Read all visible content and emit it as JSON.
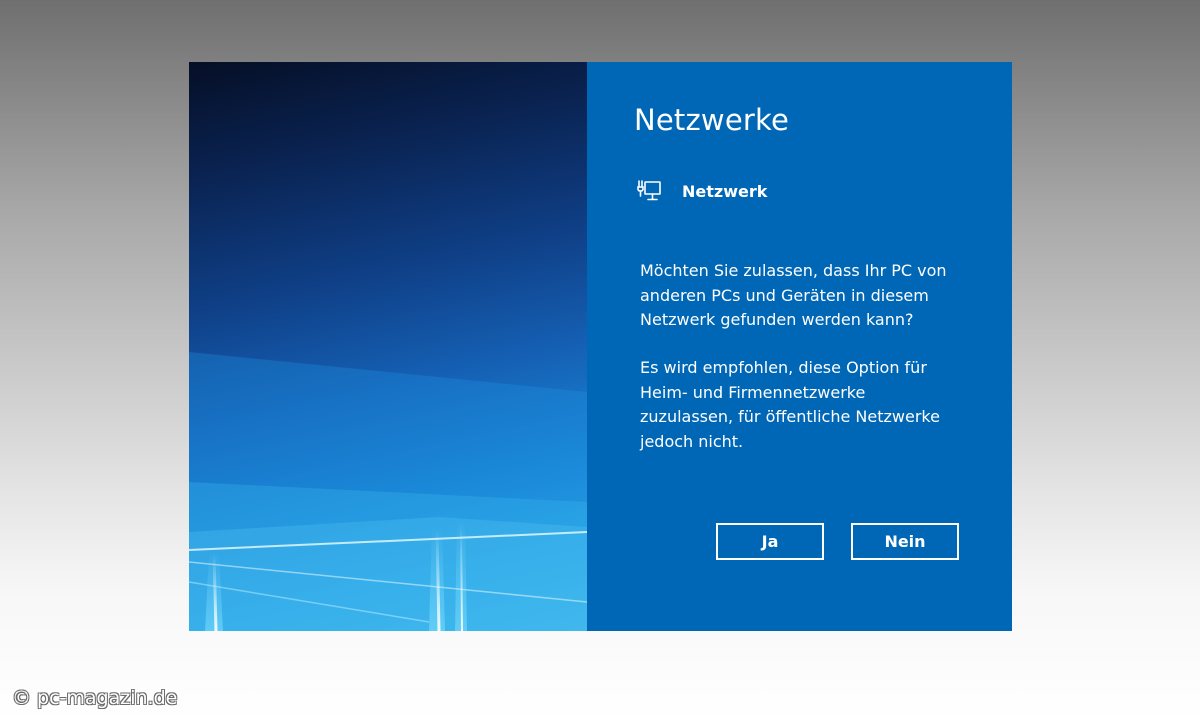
{
  "dialog": {
    "title": "Netzwerke",
    "network_icon": "network-icon",
    "network_name": "Netzwerk",
    "question": "Möchten Sie zulassen, dass Ihr PC von\nanderen PCs und Geräten in diesem\nNetzwerk gefunden werden kann?",
    "recommendation": "Es wird empfohlen, diese Option für\nHeim- und Firmennetzwerke\nzuzulassen, für öffentliche Netzwerke\njedoch nicht.",
    "yes_label": "Ja",
    "no_label": "Nein",
    "accent_color": "#0067b7"
  },
  "watermark": {
    "text": "© pc-magazin.de"
  }
}
